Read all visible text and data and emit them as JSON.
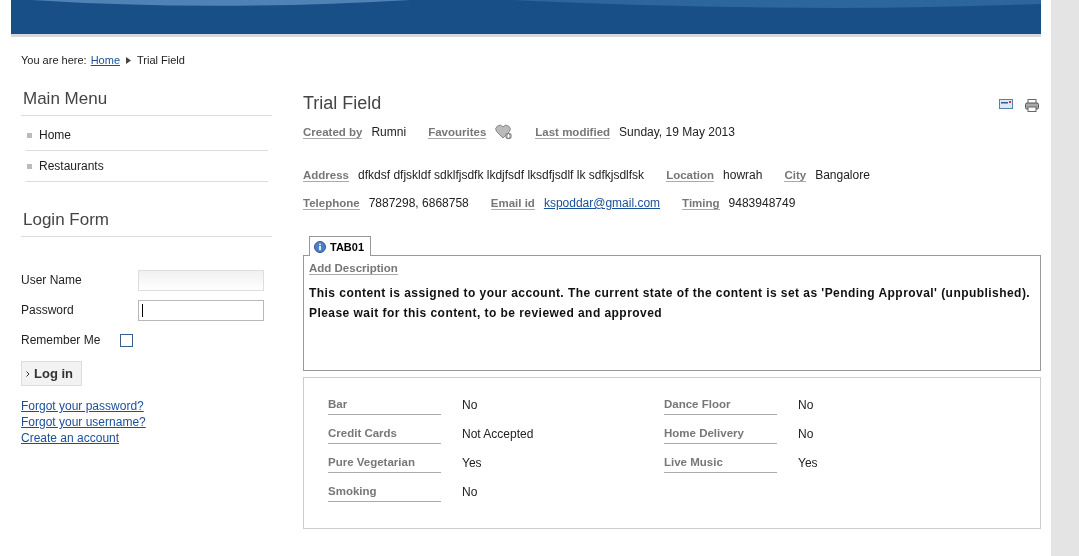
{
  "breadcrumb": {
    "prefix": "You are here:",
    "items": [
      {
        "label": "Home",
        "link": true
      },
      {
        "label": "Trial Field",
        "link": false
      }
    ]
  },
  "main_menu": {
    "title": "Main Menu",
    "items": [
      "Home",
      "Restaurants"
    ]
  },
  "login_form": {
    "title": "Login Form",
    "fields": [
      {
        "label": "User Name",
        "focused": false
      },
      {
        "label": "Password",
        "focused": true
      }
    ],
    "remember": {
      "label": "Remember Me",
      "checked": false
    },
    "button": "Log in",
    "links": [
      "Forgot your password?",
      "Forgot your username?",
      "Create an account"
    ]
  },
  "article": {
    "title": "Trial Field",
    "meta_rows": [
      [
        {
          "label": "Created by",
          "value": "Rumni",
          "kind": "text"
        },
        {
          "label": "Favourites",
          "kind": "icon"
        },
        {
          "label": "Last modified",
          "value": "Sunday, 19 May 2013",
          "kind": "text"
        }
      ],
      [
        {
          "label": "Address",
          "value": "dfkdsf dfjskldf sdklfjsdfk lkdjfsdf lksdfjsdlf lk sdfkjsdlfsk",
          "kind": "text"
        },
        {
          "label": "Location",
          "value": "howrah",
          "kind": "text"
        },
        {
          "label": "City",
          "value": "Bangalore",
          "kind": "text"
        }
      ],
      [
        {
          "label": "Telephone",
          "value": "7887298, 6868758",
          "kind": "text"
        },
        {
          "label": "Email id",
          "value": "kspoddar@gmail.com",
          "kind": "link"
        },
        {
          "label": "Timing",
          "value": "9483948749",
          "kind": "text"
        }
      ]
    ],
    "tabs": [
      {
        "label": "TAB01",
        "selected": true
      }
    ],
    "description_label": "Add Description",
    "message": "This content is assigned to your account. The current state of the content is set as 'Pending Approval' (unpublished). Please wait for this content, to be reviewed and approved",
    "amenities": [
      [
        {
          "label": "Bar",
          "value": "No"
        },
        {
          "label": "Credit Cards",
          "value": "Not Accepted"
        },
        {
          "label": "Pure Vegetarian",
          "value": "Yes"
        },
        {
          "label": "Smoking",
          "value": "No"
        }
      ],
      [
        {
          "label": "Dance Floor",
          "value": "No"
        },
        {
          "label": "Home Delivery",
          "value": "No"
        },
        {
          "label": "Live Music",
          "value": "Yes"
        }
      ]
    ]
  }
}
